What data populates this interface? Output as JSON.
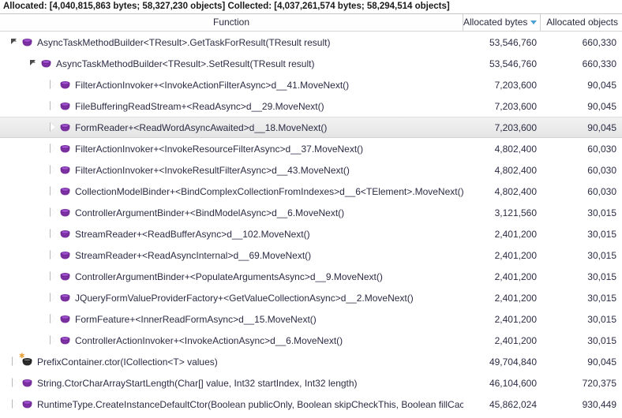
{
  "summary": {
    "text": "Allocated: [4,040,815,863 bytes; 58,327,230 objects] Collected: [4,037,261,574 bytes; 58,294,514 objects]"
  },
  "columns": {
    "function": "Function",
    "allocated_bytes": "Allocated bytes",
    "allocated_objects": "Allocated objects",
    "sort_column": "Allocated bytes",
    "sort_direction": "descending"
  },
  "colors": {
    "icon_purple": "#7a2f9e",
    "icon_purple_light": "#9b4dca",
    "icon_dark": "#2b2b2b",
    "asterisk_orange": "#e8a33d",
    "sort_indicator": "#4a9fd4",
    "row_text": "#2c2c45",
    "selected_row": "#ececec"
  },
  "rows": [
    {
      "function": "AsyncTaskMethodBuilder<TResult>.GetTaskForResult(TResult result)",
      "allocated_bytes": "53,546,760",
      "allocated_objects": "660,330",
      "level": 0,
      "expander": "expanded",
      "icon": "method-icon",
      "selected": false
    },
    {
      "function": "AsyncTaskMethodBuilder<TResult>.SetResult(TResult result)",
      "allocated_bytes": "53,546,760",
      "allocated_objects": "660,330",
      "level": 1,
      "expander": "expanded",
      "icon": "method-icon",
      "selected": false
    },
    {
      "function": "FilterActionInvoker+<InvokeActionFilterAsync>d__41.MoveNext()",
      "allocated_bytes": "7,203,600",
      "allocated_objects": "90,045",
      "level": 2,
      "expander": "collapsed",
      "icon": "method-icon",
      "selected": false
    },
    {
      "function": "FileBufferingReadStream+<ReadAsync>d__29.MoveNext()",
      "allocated_bytes": "7,203,600",
      "allocated_objects": "90,045",
      "level": 2,
      "expander": "collapsed",
      "icon": "method-icon",
      "selected": false
    },
    {
      "function": "FormReader+<ReadWordAsyncAwaited>d__18.MoveNext()",
      "allocated_bytes": "7,203,600",
      "allocated_objects": "90,045",
      "level": 2,
      "expander": "collapsed",
      "icon": "method-icon",
      "selected": true
    },
    {
      "function": "FilterActionInvoker+<InvokeResourceFilterAsync>d__37.MoveNext()",
      "allocated_bytes": "4,802,400",
      "allocated_objects": "60,030",
      "level": 2,
      "expander": "collapsed",
      "icon": "method-icon",
      "selected": false
    },
    {
      "function": "FilterActionInvoker+<InvokeResultFilterAsync>d__43.MoveNext()",
      "allocated_bytes": "4,802,400",
      "allocated_objects": "60,030",
      "level": 2,
      "expander": "collapsed",
      "icon": "method-icon",
      "selected": false
    },
    {
      "function": "CollectionModelBinder+<BindComplexCollectionFromIndexes>d__6<TElement>.MoveNext()",
      "allocated_bytes": "4,802,400",
      "allocated_objects": "60,030",
      "level": 2,
      "expander": "collapsed",
      "icon": "method-icon",
      "selected": false
    },
    {
      "function": "ControllerArgumentBinder+<BindModelAsync>d__6.MoveNext()",
      "allocated_bytes": "3,121,560",
      "allocated_objects": "30,015",
      "level": 2,
      "expander": "collapsed",
      "icon": "method-icon",
      "selected": false
    },
    {
      "function": "StreamReader+<ReadBufferAsync>d__102.MoveNext()",
      "allocated_bytes": "2,401,200",
      "allocated_objects": "30,015",
      "level": 2,
      "expander": "collapsed",
      "icon": "method-icon",
      "selected": false
    },
    {
      "function": "StreamReader+<ReadAsyncInternal>d__69.MoveNext()",
      "allocated_bytes": "2,401,200",
      "allocated_objects": "30,015",
      "level": 2,
      "expander": "collapsed",
      "icon": "method-icon",
      "selected": false
    },
    {
      "function": "ControllerArgumentBinder+<PopulateArgumentsAsync>d__9.MoveNext()",
      "allocated_bytes": "2,401,200",
      "allocated_objects": "30,015",
      "level": 2,
      "expander": "collapsed",
      "icon": "method-icon",
      "selected": false
    },
    {
      "function": "JQueryFormValueProviderFactory+<GetValueCollectionAsync>d__2.MoveNext()",
      "allocated_bytes": "2,401,200",
      "allocated_objects": "30,015",
      "level": 2,
      "expander": "collapsed",
      "icon": "method-icon",
      "selected": false
    },
    {
      "function": "FormFeature+<InnerReadFormAsync>d__15.MoveNext()",
      "allocated_bytes": "2,401,200",
      "allocated_objects": "30,015",
      "level": 2,
      "expander": "collapsed",
      "icon": "method-icon",
      "selected": false
    },
    {
      "function": "ControllerActionInvoker+<InvokeActionAsync>d__6.MoveNext()",
      "allocated_bytes": "2,401,200",
      "allocated_objects": "30,015",
      "level": 2,
      "expander": "collapsed",
      "icon": "method-icon",
      "selected": false
    },
    {
      "function": "PrefixContainer.ctor(ICollection<T> values)",
      "allocated_bytes": "49,704,840",
      "allocated_objects": "90,045",
      "level": 0,
      "expander": "collapsed",
      "icon": "method-icon-static",
      "selected": false
    },
    {
      "function": "String.CtorCharArrayStartLength(Char[] value, Int32 startIndex, Int32 length)",
      "allocated_bytes": "46,104,600",
      "allocated_objects": "720,375",
      "level": 0,
      "expander": "collapsed",
      "icon": "method-icon",
      "selected": false
    },
    {
      "function": "RuntimeType.CreateInstanceDefaultCtor(Boolean publicOnly, Boolean skipCheckThis, Boolean fillCache, StackCrawlMark& stackMark)",
      "allocated_bytes": "45,862,024",
      "allocated_objects": "930,449",
      "level": 0,
      "expander": "collapsed",
      "icon": "method-icon",
      "selected": false
    }
  ]
}
